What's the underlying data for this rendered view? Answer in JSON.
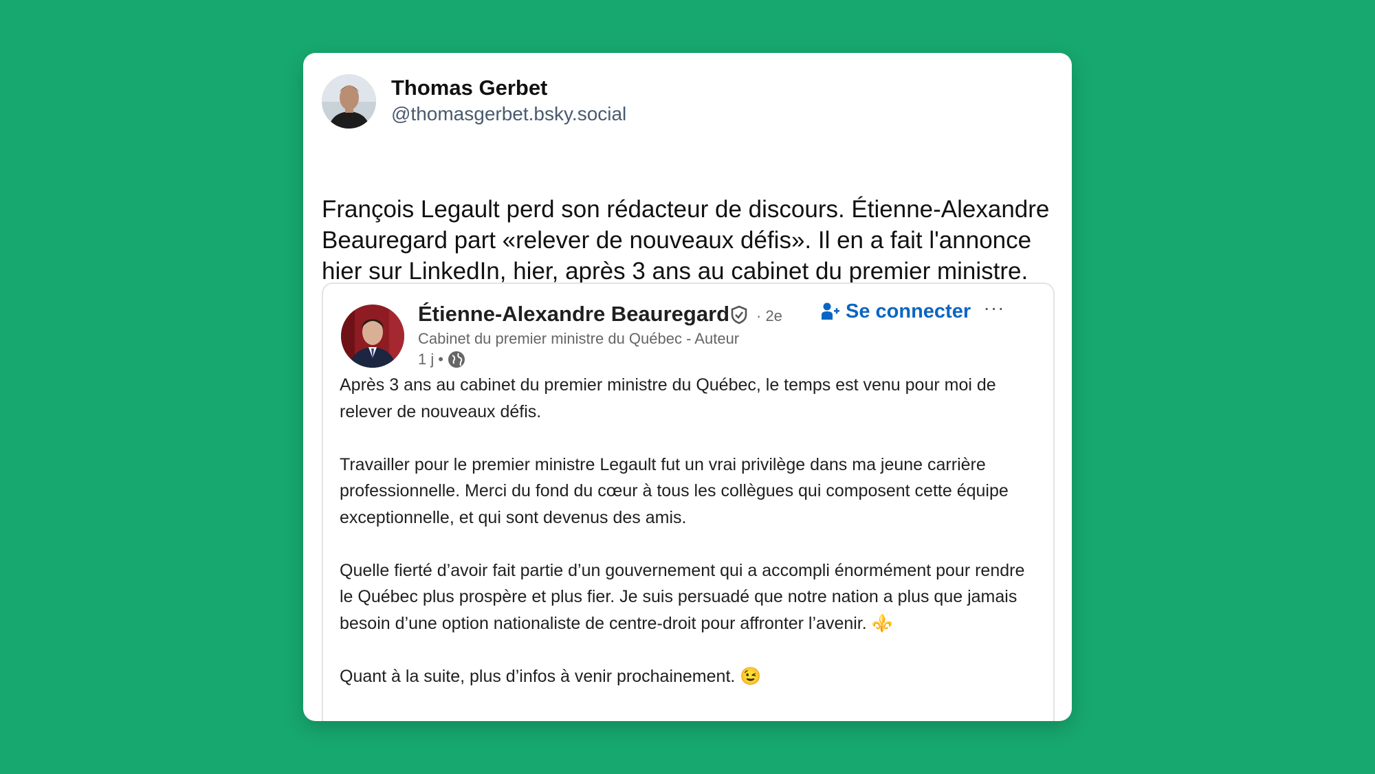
{
  "post": {
    "author_name": "Thomas Gerbet",
    "author_handle": "@thomasgerbet.bsky.social",
    "avatar_icon": "person-photo",
    "text": "François Legault perd son rédacteur de discours. Étienne-Alexandre Beauregard part «relever de nouveaux défis». Il en a fait l'annonce hier sur LinkedIn, hier, après 3 ans au cabinet du premier ministre."
  },
  "embed": {
    "name": "Étienne-Alexandre Beauregard",
    "verified_icon": "verified-shield-icon",
    "degree": "· 2e",
    "headline": "Cabinet du premier ministre du Québec - Auteur",
    "time": "1 j",
    "separator": "•",
    "visibility_icon": "globe-icon",
    "connect_label": "Se connecter",
    "connect_icon": "add-person-icon",
    "more_label": "···",
    "paragraphs": [
      "Après 3 ans au cabinet du premier ministre du Québec, le temps est venu pour moi de relever de nouveaux défis.",
      "Travailler pour le premier ministre Legault fut un vrai privilège dans ma jeune carrière professionnelle. Merci du fond du cœur à tous les collègues qui composent cette équipe exceptionnelle, et qui sont devenus des amis.",
      "Quelle fierté d’avoir fait partie d’un gouvernement qui a accompli énormément pour rendre le Québec plus prospère et plus fier. Je suis persuadé que notre nation a plus que jamais besoin d’une option nationaliste de centre-droit pour affronter l’avenir. ⚜️",
      "Quant à la suite, plus d’infos à venir prochainement. 😉"
    ]
  },
  "colors": {
    "background": "#17a86f",
    "card": "#ffffff",
    "link_blue": "#0a66c2",
    "handle": "#4a5a6e",
    "muted": "#666666"
  }
}
